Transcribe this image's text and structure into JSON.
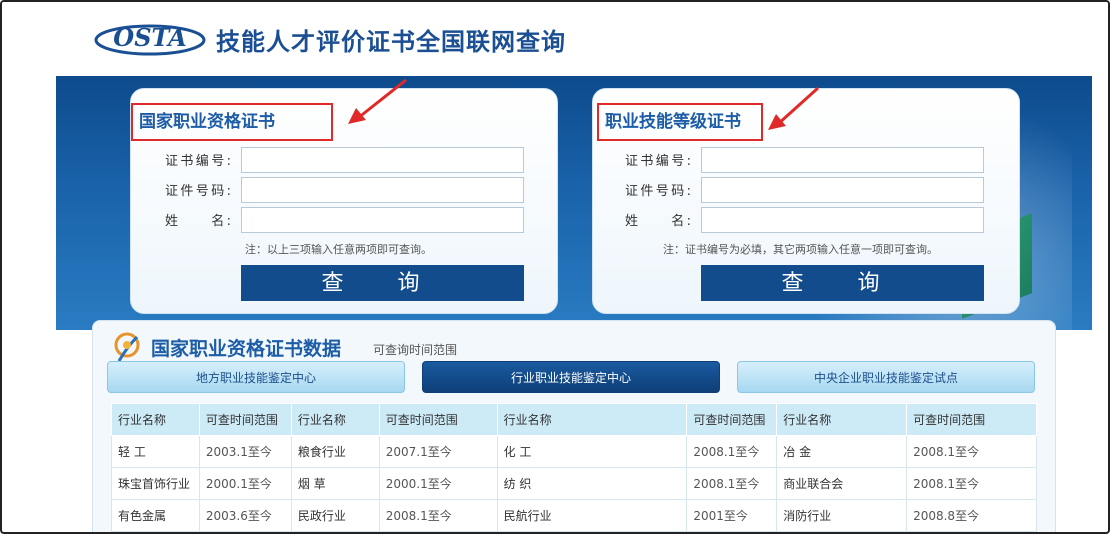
{
  "header": {
    "logo_text": "OSTA",
    "site_title": "技能人才评价证书全国联网查询"
  },
  "panels": [
    {
      "title": "国家职业资格证书",
      "fields": [
        {
          "label": "证书编号:",
          "value": ""
        },
        {
          "label": "证件号码:",
          "value": ""
        },
        {
          "label": "姓　　名:",
          "value": ""
        }
      ],
      "note": "注：以上三项输入任意两项即可查询。",
      "button": "查 询"
    },
    {
      "title": "职业技能等级证书",
      "fields": [
        {
          "label": "证书编号:",
          "value": ""
        },
        {
          "label": "证件号码:",
          "value": ""
        },
        {
          "label": "姓　　名:",
          "value": ""
        }
      ],
      "note": "注：证书编号为必填，其它两项输入任意一项即可查询。",
      "button": "查 询"
    }
  ],
  "data_section": {
    "title": "国家职业资格证书数据",
    "subtitle": "可查询时间范围",
    "tabs": [
      "地方职业技能鉴定中心",
      "行业职业技能鉴定中心",
      "中央企业职业技能鉴定试点"
    ],
    "active_tab": 1,
    "columns": [
      "行业名称",
      "可查时间范围",
      "行业名称",
      "可查时间范围",
      "行业名称",
      "可查时间范围",
      "行业名称",
      "可查时间范围"
    ],
    "rows": [
      [
        "轻 工",
        "2003.1至今",
        "粮食行业",
        "2007.1至今",
        "化 工",
        "2008.1至今",
        "冶 金",
        "2008.1至今"
      ],
      [
        "珠宝首饰行业",
        "2000.1至今",
        "烟 草",
        "2000.1至今",
        "纺 织",
        "2008.1至今",
        "商业联合会",
        "2008.1至今"
      ],
      [
        "有色金属",
        "2003.6至今",
        "民政行业",
        "2008.1至今",
        "民航行业",
        "2001至今",
        "消防行业",
        "2008.8至今"
      ]
    ]
  },
  "colors": {
    "brand_blue": "#1d5da7",
    "button_blue": "#134c8d",
    "highlight_red": "#e02a2a"
  }
}
